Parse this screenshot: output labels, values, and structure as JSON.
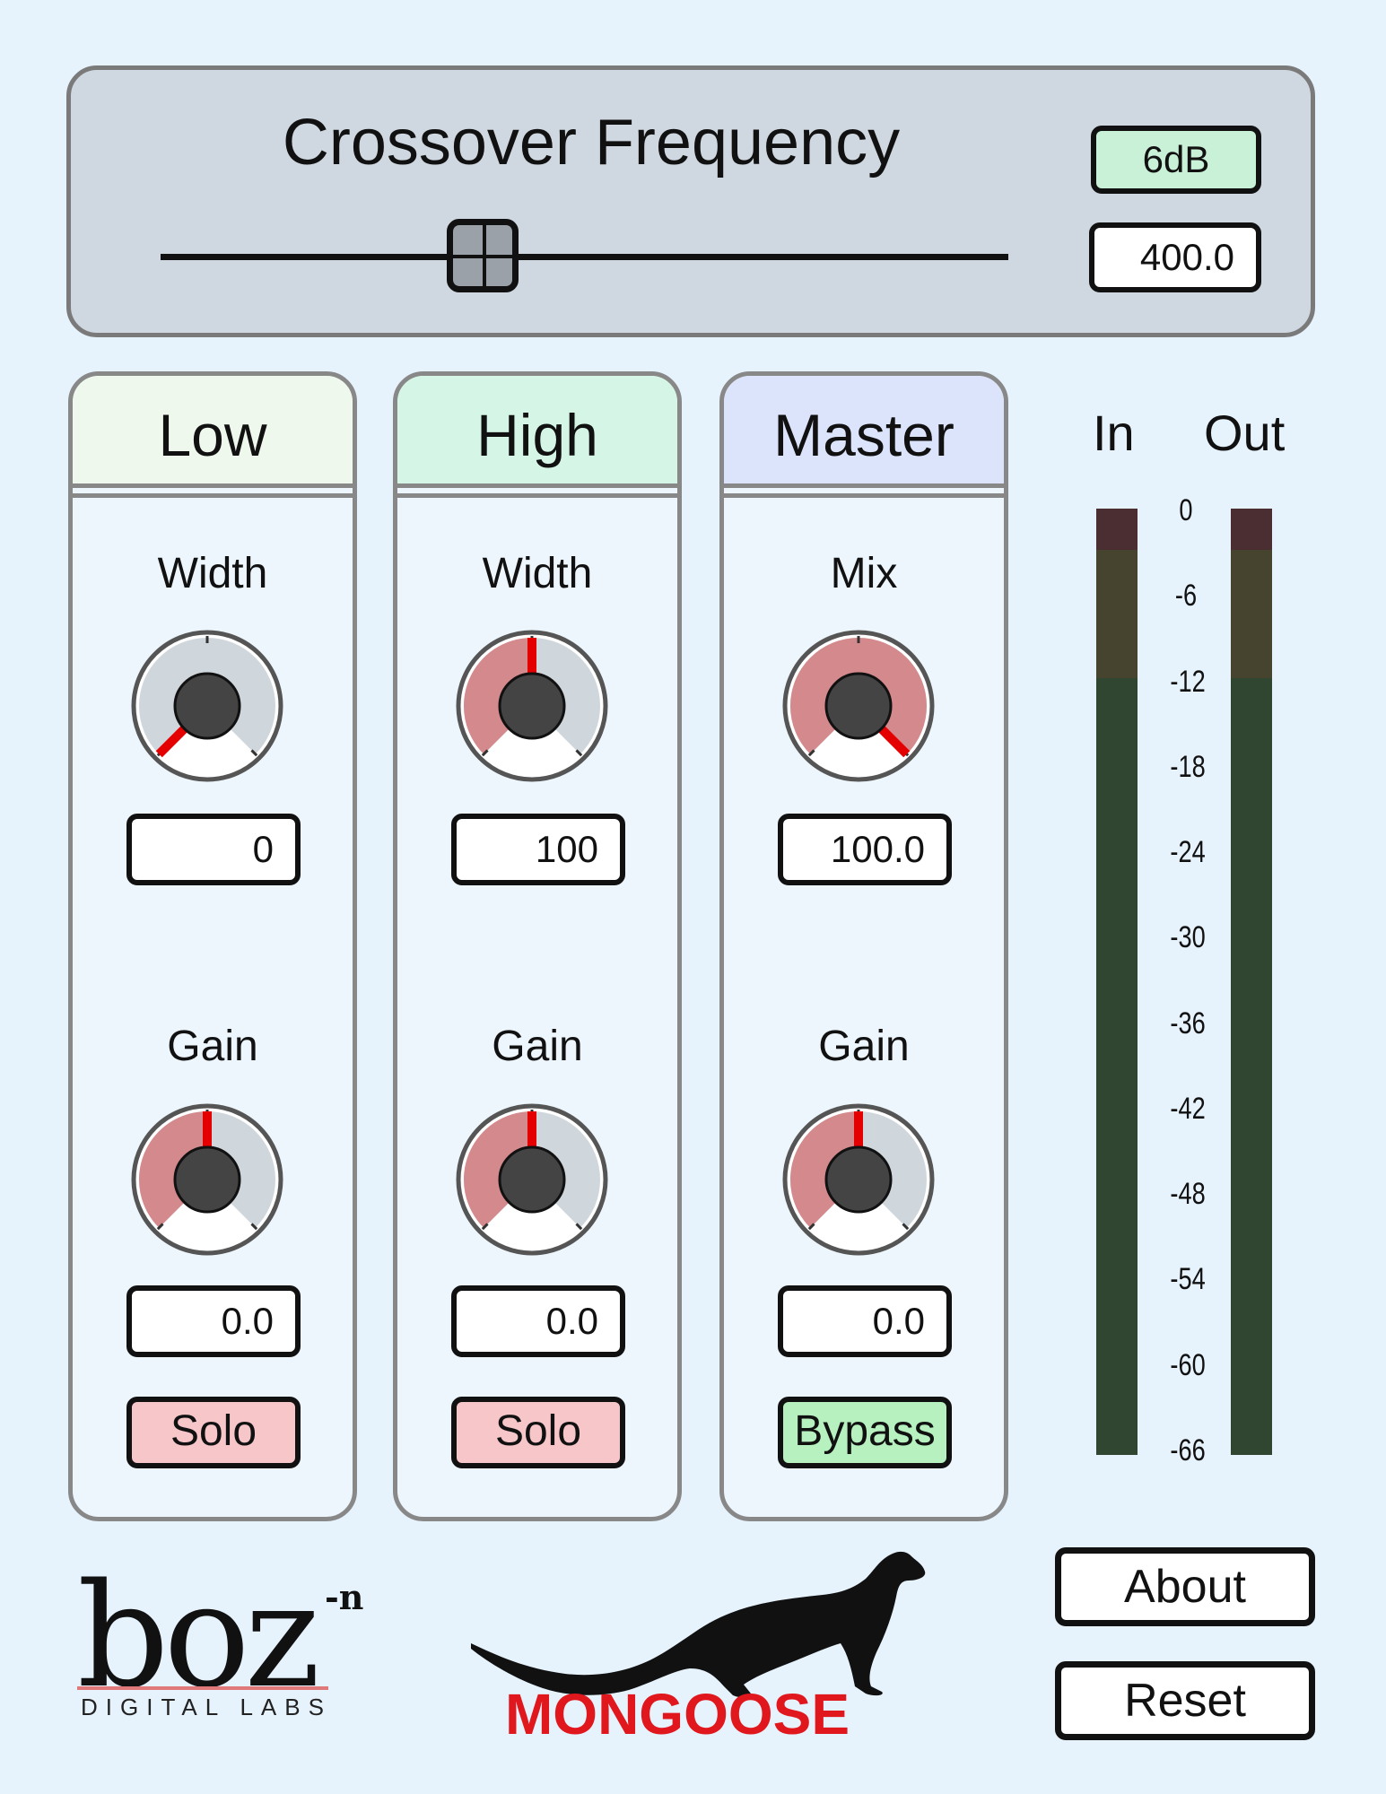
{
  "crossover": {
    "title": "Crossover Frequency",
    "slope": "6dB",
    "frequency": "400.0",
    "slider_position": 0.38
  },
  "bands": [
    {
      "title": "Low",
      "header_color": "#eef8ec",
      "width_label": "Width",
      "width_value": "0",
      "width_level": 0.0,
      "gain_label": "Gain",
      "gain_value": "0.0",
      "gain_level": 0.5,
      "button_label": "Solo"
    },
    {
      "title": "High",
      "header_color": "#d5f6e6",
      "width_label": "Width",
      "width_value": "100",
      "width_level": 0.5,
      "gain_label": "Gain",
      "gain_value": "0.0",
      "gain_level": 0.5,
      "button_label": "Solo"
    },
    {
      "title": "Master",
      "header_color": "#dbe4fb",
      "width_label": "Mix",
      "width_value": "100.0",
      "width_level": 1.0,
      "gain_label": "Gain",
      "gain_value": "0.0",
      "gain_level": 0.5,
      "button_label": "Bypass"
    }
  ],
  "meters": {
    "in_label": "In",
    "out_label": "Out",
    "scale": [
      "0",
      "-6",
      "-12",
      "-18",
      "-24",
      "-30",
      "-36",
      "-42",
      "-48",
      "-54",
      "-60",
      "-66"
    ]
  },
  "branding": {
    "company_word": "boz",
    "company_superscript": "-n",
    "company_subtitle": "DIGITAL LABS",
    "product_name": "MONGOOSE"
  },
  "buttons": {
    "about": "About",
    "reset": "Reset"
  },
  "colors": {
    "knob_active": "#d4898c",
    "knob_inactive": "#cfd6dc",
    "knob_pointer": "#e40000",
    "solo": "#f6c6c9",
    "bypass": "#b7f1c0",
    "brand_red": "#e0181e"
  }
}
